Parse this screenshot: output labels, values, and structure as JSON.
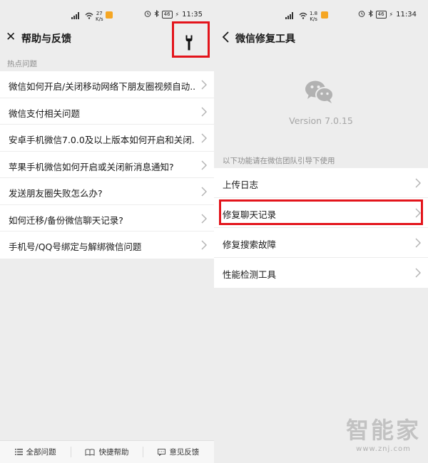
{
  "left": {
    "status": {
      "speed_value": "27",
      "speed_unit": "K/s",
      "battery": "46",
      "time": "11:35"
    },
    "nav": {
      "title": "帮助与反馈",
      "close_glyph": "✕"
    },
    "section": "热点问题",
    "items": [
      "微信如何开启/关闭移动网络下朋友圈视频自动...",
      "微信支付相关问题",
      "安卓手机微信7.0.0及以上版本如何开启和关闭...",
      "苹果手机微信如何开启或关闭新消息通知?",
      "发送朋友圈失败怎么办?",
      "如何迁移/备份微信聊天记录?",
      "手机号/QQ号绑定与解绑微信问题"
    ],
    "footer": {
      "tabs": [
        {
          "label": "全部问题",
          "icon": "list-icon"
        },
        {
          "label": "快捷帮助",
          "icon": "book-icon"
        },
        {
          "label": "意见反馈",
          "icon": "message-icon"
        }
      ]
    }
  },
  "right": {
    "status": {
      "speed_value": "1.8",
      "speed_unit": "K/s",
      "battery": "46",
      "time": "11:34"
    },
    "nav": {
      "title": "微信修复工具"
    },
    "version": "Version 7.0.15",
    "section": "以下功能请在微信团队引导下使用",
    "items": [
      "上传日志",
      "修复聊天记录",
      "修复搜索故障",
      "性能检测工具"
    ]
  },
  "watermark": {
    "main": "智能家",
    "sub": "www.znj.com"
  },
  "colors": {
    "highlight": "#e3141b",
    "background": "#ededed",
    "status_badge": "#f5a623"
  }
}
